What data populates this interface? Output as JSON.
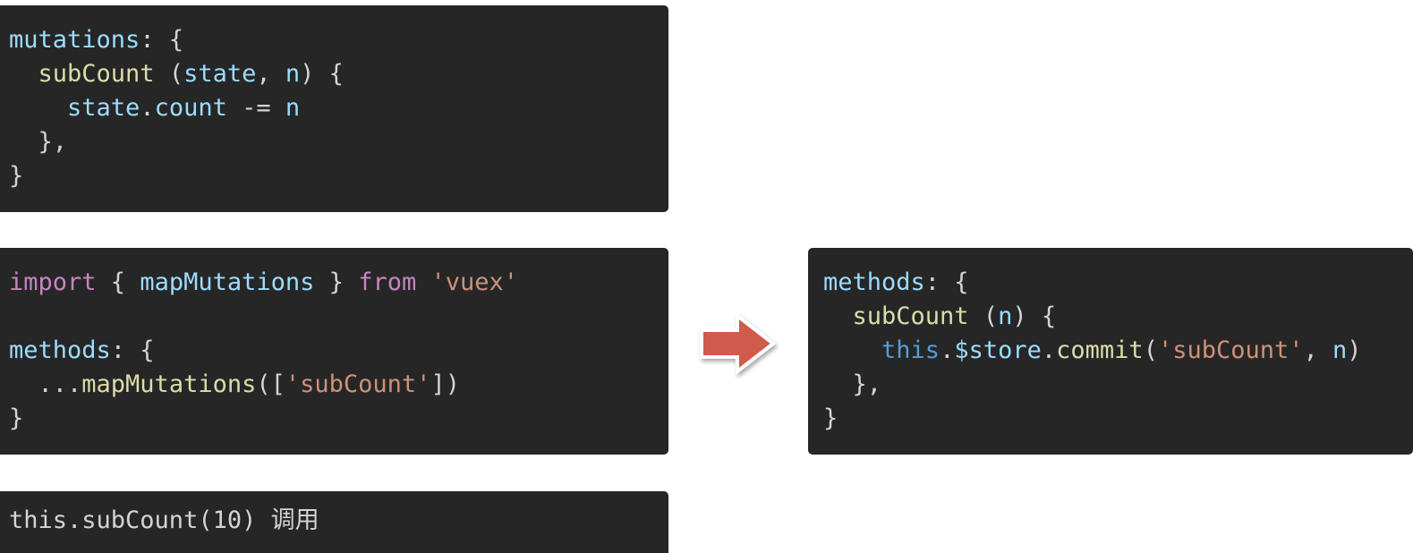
{
  "colors": {
    "background": "#ffffff",
    "code_bg": "#262626",
    "property": "#9cdcfe",
    "function": "#dcdcaa",
    "keyword": "#c586c0",
    "string": "#ce9178",
    "this_keyword": "#569cd6",
    "punctuation": "#d4d4d4",
    "arrow_fill": "#d05a4c"
  },
  "arrow": {
    "icon": "right-arrow-icon"
  },
  "blocks": {
    "mutations": {
      "lines": [
        [
          {
            "t": "mutations",
            "c": "prop"
          },
          {
            "t": ": {",
            "c": "punc"
          }
        ],
        [
          {
            "t": "  ",
            "c": "punc"
          },
          {
            "t": "subCount",
            "c": "fn"
          },
          {
            "t": " (",
            "c": "punc"
          },
          {
            "t": "state",
            "c": "prop"
          },
          {
            "t": ", ",
            "c": "punc"
          },
          {
            "t": "n",
            "c": "prop"
          },
          {
            "t": ") {",
            "c": "punc"
          }
        ],
        [
          {
            "t": "    ",
            "c": "punc"
          },
          {
            "t": "state",
            "c": "prop"
          },
          {
            "t": ".",
            "c": "punc"
          },
          {
            "t": "count",
            "c": "prop"
          },
          {
            "t": " -= ",
            "c": "punc"
          },
          {
            "t": "n",
            "c": "prop"
          }
        ],
        [
          {
            "t": "  },",
            "c": "punc"
          }
        ],
        [
          {
            "t": "}",
            "c": "punc"
          }
        ]
      ]
    },
    "map": {
      "lines": [
        [
          {
            "t": "import",
            "c": "kw"
          },
          {
            "t": " { ",
            "c": "punc"
          },
          {
            "t": "mapMutations",
            "c": "prop"
          },
          {
            "t": " } ",
            "c": "punc"
          },
          {
            "t": "from",
            "c": "kw"
          },
          {
            "t": " ",
            "c": "punc"
          },
          {
            "t": "'vuex'",
            "c": "str"
          }
        ],
        [
          {
            "t": "",
            "c": "punc"
          }
        ],
        [
          {
            "t": "methods",
            "c": "prop"
          },
          {
            "t": ": {",
            "c": "punc"
          }
        ],
        [
          {
            "t": "  ...",
            "c": "punc"
          },
          {
            "t": "mapMutations",
            "c": "fn"
          },
          {
            "t": "([",
            "c": "punc"
          },
          {
            "t": "'subCount'",
            "c": "str"
          },
          {
            "t": "])",
            "c": "punc"
          }
        ],
        [
          {
            "t": "}",
            "c": "punc"
          }
        ]
      ]
    },
    "methods": {
      "lines": [
        [
          {
            "t": "methods",
            "c": "prop"
          },
          {
            "t": ": {",
            "c": "punc"
          }
        ],
        [
          {
            "t": "  ",
            "c": "punc"
          },
          {
            "t": "subCount",
            "c": "fn"
          },
          {
            "t": " (",
            "c": "punc"
          },
          {
            "t": "n",
            "c": "prop"
          },
          {
            "t": ") {",
            "c": "punc"
          }
        ],
        [
          {
            "t": "    ",
            "c": "punc"
          },
          {
            "t": "this",
            "c": "kwblue"
          },
          {
            "t": ".",
            "c": "punc"
          },
          {
            "t": "$store",
            "c": "prop"
          },
          {
            "t": ".",
            "c": "punc"
          },
          {
            "t": "commit",
            "c": "fn"
          },
          {
            "t": "(",
            "c": "punc"
          },
          {
            "t": "'subCount'",
            "c": "str"
          },
          {
            "t": ", ",
            "c": "punc"
          },
          {
            "t": "n",
            "c": "prop"
          },
          {
            "t": ")",
            "c": "punc"
          }
        ],
        [
          {
            "t": "  },",
            "c": "punc"
          }
        ],
        [
          {
            "t": "}",
            "c": "punc"
          }
        ]
      ]
    },
    "call": {
      "lines": [
        [
          {
            "t": "this.subCount(10) 调用",
            "c": "punc"
          }
        ]
      ]
    }
  }
}
